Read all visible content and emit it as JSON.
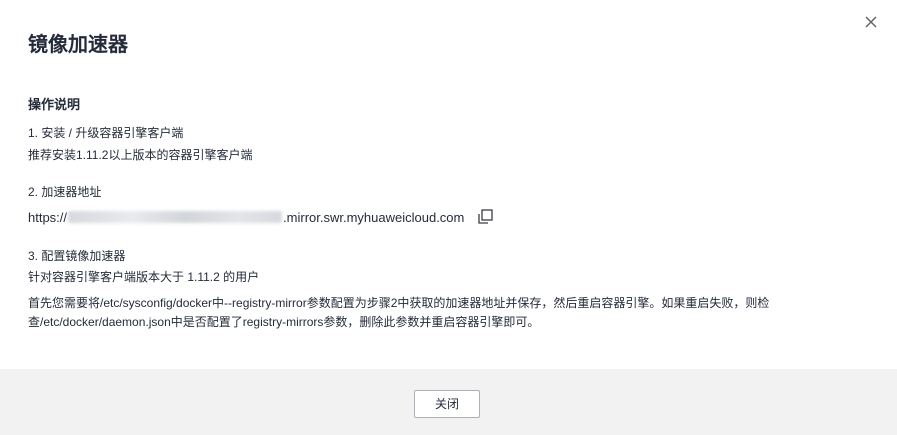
{
  "dialog": {
    "title": "镜像加速器",
    "close_icon": "close-icon"
  },
  "instructions": {
    "heading": "操作说明",
    "step1": {
      "title": "1. 安装 / 升级容器引擎客户端",
      "desc": "推荐安装1.11.2以上版本的容器引擎客户端"
    },
    "step2": {
      "title": "2. 加速器地址",
      "url_prefix": "https://",
      "url_suffix": ".mirror.swr.myhuaweicloud.com",
      "copy_icon": "copy-icon"
    },
    "step3": {
      "title": "3. 配置镜像加速器",
      "desc": "针对容器引擎客户端版本大于 1.11.2 的用户",
      "paragraph": "首先您需要将/etc/sysconfig/docker中--registry-mirror参数配置为步骤2中获取的加速器地址并保存，然后重启容器引擎。如果重启失败，则检查/etc/docker/daemon.json中是否配置了registry-mirrors参数，删除此参数并重启容器引擎即可。"
    }
  },
  "footer": {
    "close_label": "关闭"
  }
}
